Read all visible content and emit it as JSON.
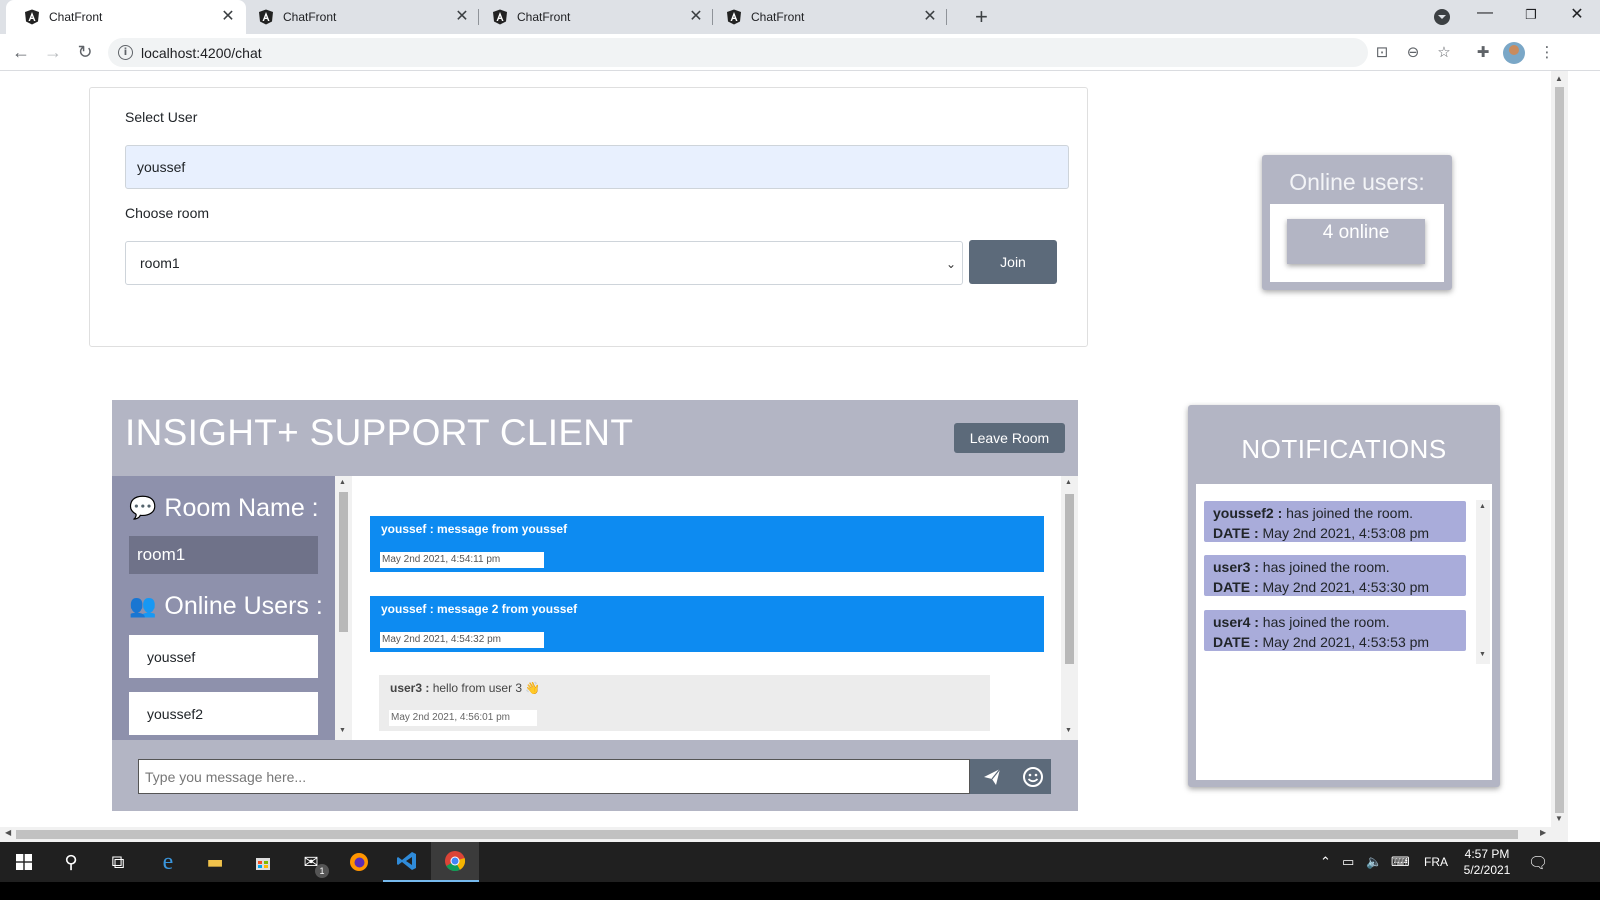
{
  "browser": {
    "tabs": [
      {
        "title": "ChatFront",
        "active": true
      },
      {
        "title": "ChatFront",
        "active": false
      },
      {
        "title": "ChatFront",
        "active": false
      },
      {
        "title": "ChatFront",
        "active": false
      }
    ],
    "url": "localhost:4200/chat"
  },
  "form": {
    "select_user_label": "Select User",
    "user_value": "youssef",
    "choose_room_label": "Choose room",
    "room_value": "room1",
    "join_label": "Join"
  },
  "online_widget": {
    "title": "Online users:",
    "count_text": "4 online"
  },
  "chat": {
    "heading": "INSIGHT+ SUPPORT CLIENT",
    "leave_label": "Leave Room",
    "room_name_heading": "Room Name :",
    "room_name": "room1",
    "online_users_heading": "Online Users :",
    "online_users": [
      "youssef",
      "youssef2"
    ],
    "messages": [
      {
        "user": "youssef",
        "sep": " : ",
        "text": "message from youssef",
        "date": "May 2nd 2021, 4:54:11 pm",
        "own": true
      },
      {
        "user": "youssef",
        "sep": " : ",
        "text": "message 2 from youssef",
        "date": "May 2nd 2021, 4:54:32 pm",
        "own": true
      },
      {
        "user": "user3",
        "sep": " : ",
        "text": "hello from user 3 👋",
        "date": "May 2nd 2021, 4:56:01 pm",
        "own": false
      }
    ],
    "input_placeholder": "Type you message here..."
  },
  "notifications": {
    "title": "NOTIFICATIONS",
    "date_label": "DATE :",
    "items": [
      {
        "user": "youssef2 :",
        "text": " has joined the room.",
        "date": " May 2nd 2021, 4:53:08 pm"
      },
      {
        "user": "user3 :",
        "text": " has joined the room.",
        "date": " May 2nd 2021, 4:53:30 pm"
      },
      {
        "user": "user4 :",
        "text": " has joined the room.",
        "date": " May 2nd 2021, 4:53:53 pm"
      }
    ]
  },
  "taskbar": {
    "language": "FRA",
    "time": "4:57 PM",
    "date": "5/2/2021",
    "mail_badge": "1"
  },
  "colors": {
    "panel": "#b3b5c4",
    "sidebar": "#8e91ac",
    "own_message": "#0d8bf1",
    "button": "#5c6a7a",
    "notification_item": "#a9acda"
  }
}
